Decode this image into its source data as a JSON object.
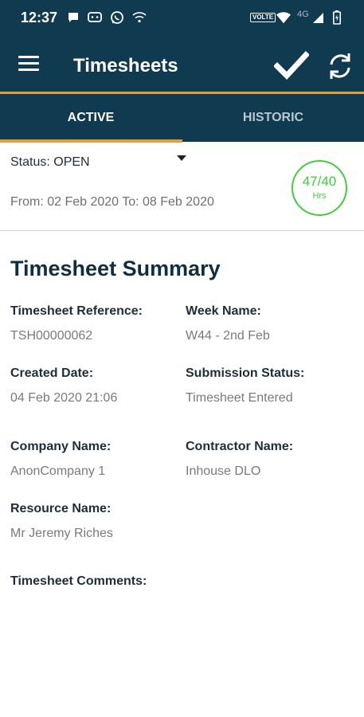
{
  "status_bar": {
    "time": "12:37",
    "volte": "VOLTE",
    "network": "4G"
  },
  "app_bar": {
    "title": "Timesheets"
  },
  "tabs": [
    {
      "label": "ACTIVE",
      "active": true
    },
    {
      "label": "HISTORIC",
      "active": false
    }
  ],
  "status_panel": {
    "status": "Status: OPEN",
    "date_range": "From: 02 Feb 2020 To: 08 Feb 2020",
    "hours_value": "47/40",
    "hours_unit": "Hrs"
  },
  "summary": {
    "title": "Timesheet Summary",
    "fields": [
      {
        "label": "Timesheet Reference:",
        "value": "TSH00000062"
      },
      {
        "label": "Week Name:",
        "value": "W44 - 2nd Feb"
      },
      {
        "label": "Created Date:",
        "value": "04 Feb 2020 21:06"
      },
      {
        "label": "Submission Status:",
        "value": "Timesheet Entered"
      },
      {
        "label": "Company Name:",
        "value": "AnonCompany 1"
      },
      {
        "label": "Contractor Name:",
        "value": "Inhouse DLO"
      },
      {
        "label": "Resource Name:",
        "value": "Mr Jeremy Riches"
      },
      {
        "label": "Timesheet Comments:",
        "value": ""
      }
    ]
  },
  "colors": {
    "header": "#0f3a4f",
    "accent": "#e1a13a",
    "hours_ring": "#3fcf3a"
  }
}
